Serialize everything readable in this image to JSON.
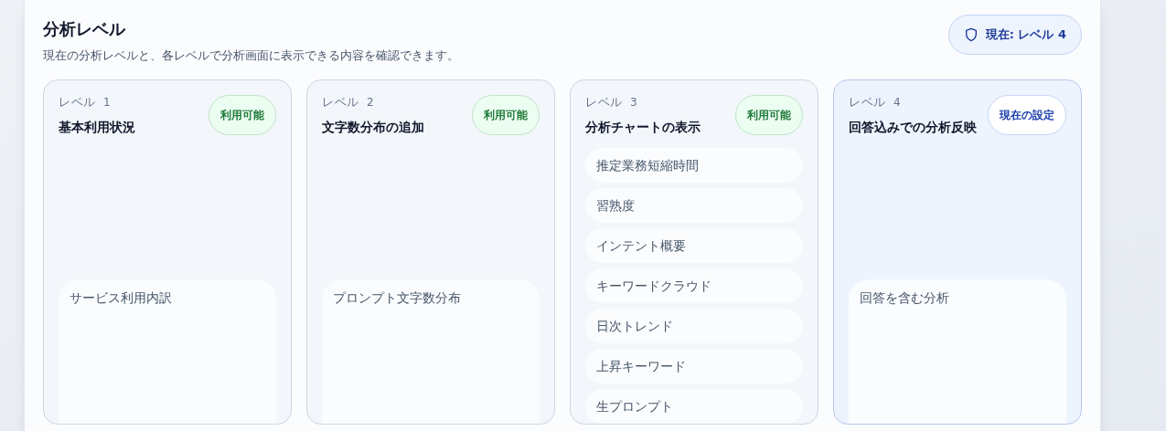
{
  "header": {
    "title": "分析レベル",
    "subtitle": "現在の分析レベルと、各レベルで分析画面に表示できる内容を確認できます。",
    "current_badge": "現在: レベル 4"
  },
  "levels": [
    {
      "label": "レベル",
      "number": "1",
      "title": "基本利用状況",
      "selected": false,
      "status": {
        "kind": "available",
        "text": "利用可能"
      },
      "items": [
        "サービス利用内訳"
      ]
    },
    {
      "label": "レベル",
      "number": "2",
      "title": "文字数分布の追加",
      "selected": false,
      "status": {
        "kind": "available",
        "text": "利用可能"
      },
      "items": [
        "プロンプト文字数分布"
      ]
    },
    {
      "label": "レベル",
      "number": "3",
      "title": "分析チャートの表示",
      "selected": false,
      "status": {
        "kind": "available",
        "text": "利用可能"
      },
      "items": [
        "推定業務短縮時間",
        "習熟度",
        "インテント概要",
        "キーワードクラウド",
        "日次トレンド",
        "上昇キーワード",
        "生プロンプト"
      ]
    },
    {
      "label": "レベル",
      "number": "4",
      "title": "回答込みでの分析反映",
      "selected": true,
      "status": {
        "kind": "current",
        "text": "現在の設定"
      },
      "items": [
        "回答を含む分析"
      ]
    }
  ]
}
